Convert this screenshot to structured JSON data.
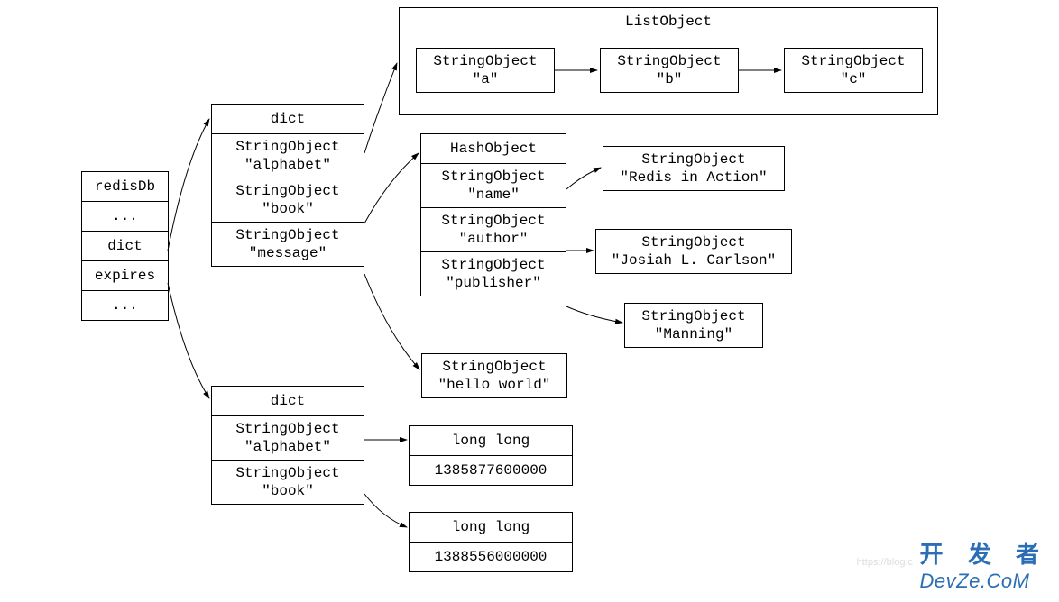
{
  "redisDb": {
    "title": "redisDb",
    "rows": [
      "...",
      "dict",
      "expires",
      "..."
    ]
  },
  "dictMain": {
    "title": "dict",
    "keys": [
      {
        "type": "StringObject",
        "val": "\"alphabet\""
      },
      {
        "type": "StringObject",
        "val": "\"book\""
      },
      {
        "type": "StringObject",
        "val": "\"message\""
      }
    ]
  },
  "listObject": {
    "title": "ListObject",
    "items": [
      {
        "type": "StringObject",
        "val": "\"a\""
      },
      {
        "type": "StringObject",
        "val": "\"b\""
      },
      {
        "type": "StringObject",
        "val": "\"c\""
      }
    ]
  },
  "hashObject": {
    "title": "HashObject",
    "fields": [
      {
        "type": "StringObject",
        "val": "\"name\""
      },
      {
        "type": "StringObject",
        "val": "\"author\""
      },
      {
        "type": "StringObject",
        "val": "\"publisher\""
      }
    ],
    "values": [
      {
        "type": "StringObject",
        "val": "\"Redis in Action\""
      },
      {
        "type": "StringObject",
        "val": "\"Josiah L. Carlson\""
      },
      {
        "type": "StringObject",
        "val": "\"Manning\""
      }
    ]
  },
  "messageValue": {
    "type": "StringObject",
    "val": "\"hello world\""
  },
  "dictExpires": {
    "title": "dict",
    "keys": [
      {
        "type": "StringObject",
        "val": "\"alphabet\""
      },
      {
        "type": "StringObject",
        "val": "\"book\""
      }
    ],
    "values": [
      {
        "type": "long long",
        "val": "1385877600000"
      },
      {
        "type": "long long",
        "val": "1388556000000"
      }
    ]
  },
  "watermark": {
    "cn": "开 发 者",
    "en": "DevZe.CoM",
    "faint": "https://blog.c"
  }
}
